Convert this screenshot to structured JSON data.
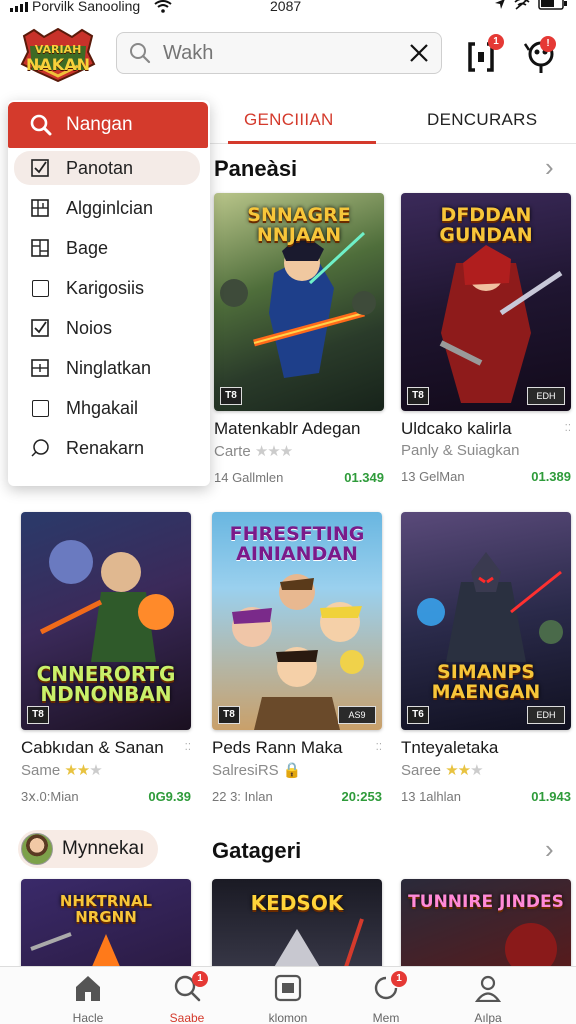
{
  "status_bar": {
    "carrier": "Porvilk Sanooling",
    "time": "2087"
  },
  "search": {
    "placeholder": "Wakh"
  },
  "header": {
    "logo_line1": "VARIAH",
    "logo_line2": "NAKAN",
    "notif_badge": "1",
    "profile_badge": "!"
  },
  "tabs": [
    {
      "label": "GENCIIIAN",
      "active": true
    },
    {
      "label": "DENCURARS",
      "active": false
    }
  ],
  "dropdown": {
    "header": "Nangan",
    "items": [
      {
        "label": "Panotan",
        "icon": "checkbox-checked-icon",
        "selected": true
      },
      {
        "label": "Algginlcian",
        "icon": "grid-icon",
        "selected": false
      },
      {
        "label": "Bage",
        "icon": "layout-icon",
        "selected": false
      },
      {
        "label": "Karigosiis",
        "icon": "checkbox-icon",
        "selected": false
      },
      {
        "label": "Noios",
        "icon": "checkbox-checked-icon",
        "selected": false
      },
      {
        "label": "Ninglatkan",
        "icon": "split-icon",
        "selected": false
      },
      {
        "label": "Mhgakail",
        "icon": "checkbox-icon",
        "selected": false
      },
      {
        "label": "Renakarn",
        "icon": "chat-icon",
        "selected": false
      }
    ]
  },
  "sections": {
    "popular": {
      "title": "Paneàsi"
    },
    "categories": {
      "title": "Gatageri"
    }
  },
  "user_chip": {
    "name": "Mynnekaı"
  },
  "games_row1": [
    {
      "cover_title": "SNNAGRE NNJAAN",
      "rating": "T8",
      "publisher": "",
      "name": "Matenkablr Adegan",
      "sub": "Carte",
      "stars": 0,
      "downloads": "14 Gallmlen",
      "price": "01.349"
    },
    {
      "cover_title": "DFDDAN GUNDAN",
      "rating": "T8",
      "publisher": "EDH",
      "name": "Uldcako kalirla",
      "sub": "Panly & Suiagkan",
      "stars": -1,
      "downloads": "13 GelMan",
      "price": "01.389"
    }
  ],
  "games_row2": [
    {
      "cover_title": "CNNERORTG NDNONBAN",
      "rating": "T8",
      "publisher": "",
      "name": "Cabkıdan & Sanan",
      "sub": "Same",
      "stars": 2,
      "downloads": "3ⅹ.0:Mian",
      "price": "0G9.39"
    },
    {
      "cover_title": "FHRESFTING AINIANDAN",
      "rating": "T8",
      "publisher": "AS9",
      "name": "Peds Rann Maka",
      "sub": "SalresiRS",
      "stars": -1,
      "downloads": "22 3: Inlan",
      "price": "20:253"
    },
    {
      "cover_title": "SIMANPS MAENGAN",
      "rating": "T6",
      "publisher": "EDH",
      "name": "Tnteyaletaka",
      "sub": "Saree",
      "stars": 2,
      "downloads": "13 1alhlan",
      "price": "01.943"
    }
  ],
  "bottom_row": [
    {
      "cover_title": "NHKTRNAL NRGNN"
    },
    {
      "cover_title": "KEDSOK"
    },
    {
      "cover_title": "TUNNIRE JINDES"
    }
  ],
  "bottom_nav": [
    {
      "label": "Hacle",
      "icon": "home-icon",
      "active": false,
      "badge": ""
    },
    {
      "label": "Saabe",
      "icon": "search-icon",
      "active": true,
      "badge": "1"
    },
    {
      "label": "klomon",
      "icon": "library-icon",
      "active": false,
      "badge": ""
    },
    {
      "label": "Mem",
      "icon": "notification-icon",
      "active": false,
      "badge": "1"
    },
    {
      "label": "Aılpa",
      "icon": "profile-icon",
      "active": false,
      "badge": ""
    }
  ],
  "colors": {
    "accent": "#d43a2c",
    "price_green": "#2e9b3a",
    "star_gold": "#e8c341"
  }
}
